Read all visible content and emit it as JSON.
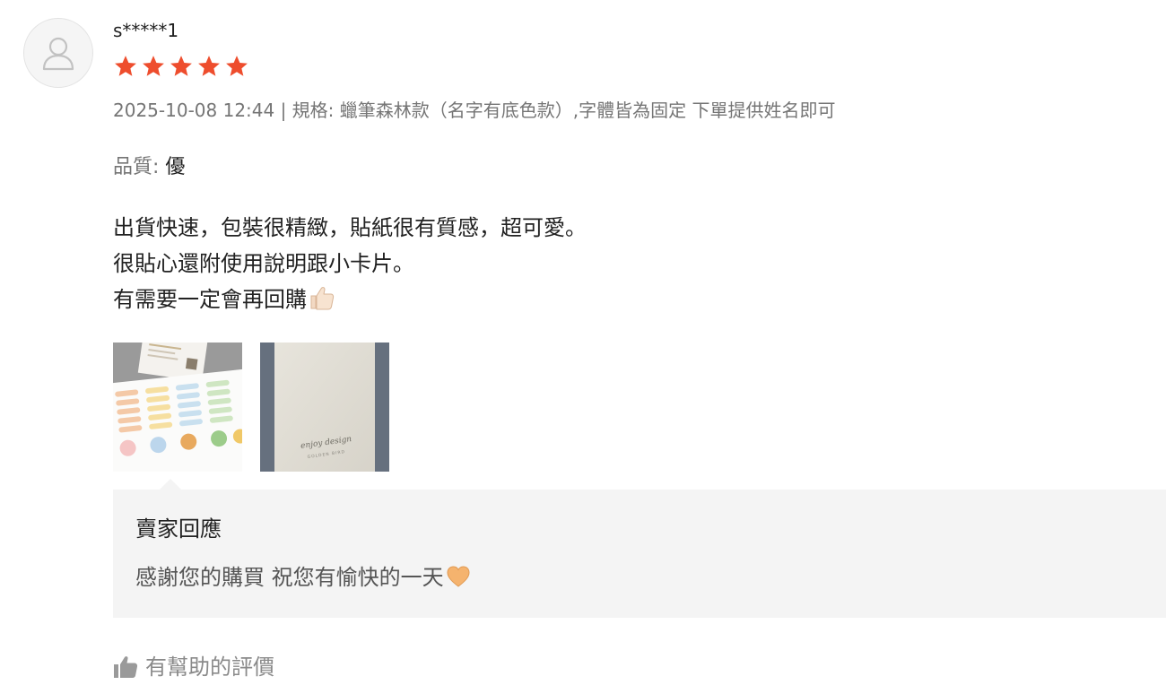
{
  "review": {
    "username": "s*****1",
    "rating": 5,
    "rating_max": 5,
    "star_color": "#ee4d2d",
    "meta": "2025-10-08 12:44 | 規格: 蠟筆森林款（名字有底色款）,字體皆為固定 下單提供姓名即可",
    "quality_label": "品質: ",
    "quality_value": "優",
    "comment_lines": [
      "出貨快速，包裝很精緻，貼紙很有質感，超可愛。",
      "很貼心還附使用說明跟小卡片。",
      "有需要一定會再回購"
    ],
    "comment_emoji": "thumbs-up-icon",
    "photos": [
      {
        "name": "sticker-sheet-photo"
      },
      {
        "name": "envelope-photo",
        "text": "enjoy design",
        "subtext": "GOLDEN BIRD"
      }
    ]
  },
  "seller_reply": {
    "title": "賣家回應",
    "text": "感謝您的購買 祝您有愉快的一天",
    "emoji": "orange-heart-icon"
  },
  "helpful": {
    "label": "有幫助的評價",
    "icon": "thumbs-up-icon"
  }
}
